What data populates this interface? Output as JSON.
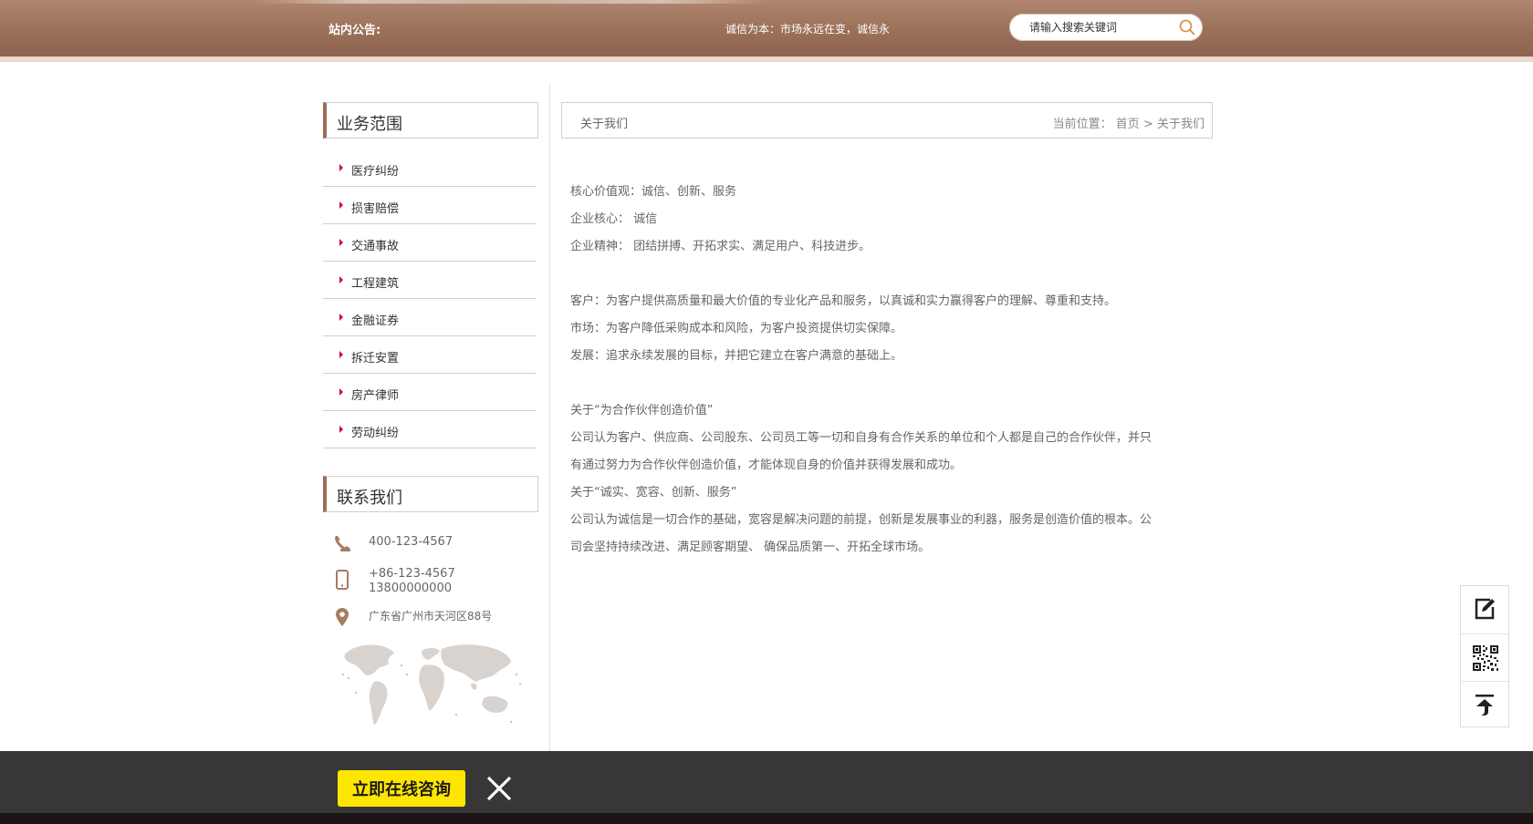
{
  "header": {
    "notice_label": "站内公告:",
    "notice_text": "诚信为本：市场永远在变，诚信永",
    "search_placeholder": "请输入搜索关键词"
  },
  "sidebar": {
    "business_title": "业务范围",
    "items": [
      {
        "label": "医疗纠纷"
      },
      {
        "label": "损害赔偿"
      },
      {
        "label": "交通事故"
      },
      {
        "label": "工程建筑"
      },
      {
        "label": "金融证券"
      },
      {
        "label": "拆迁安置"
      },
      {
        "label": "房产律师"
      },
      {
        "label": "劳动纠纷"
      }
    ],
    "contact_title": "联系我们",
    "contact": {
      "phone": "400-123-4567",
      "mobile_1": "+86-123-4567",
      "mobile_2": "13800000000",
      "address": "广东省广州市天河区88号"
    }
  },
  "breadcrumb": {
    "title": "关于我们",
    "prefix": "当前位置：",
    "home": "首页",
    "separator": ">",
    "current": "关于我们"
  },
  "content": {
    "lines": [
      "核心价值观：诚信、创新、服务",
      "企业核心： 诚信",
      "企业精神： 团结拼搏、开拓求实、满足用户、科技进步。",
      "客户：为客户提供高质量和最大价值的专业化产品和服务，以真诚和实力赢得客户的理解、尊重和支持。",
      "市场：为客户降低采购成本和风险，为客户投资提供切实保障。",
      "发展：追求永续发展的目标，并把它建立在客户满意的基础上。",
      "关于“为合作伙伴创造价值”",
      "公司认为客户、供应商、公司股东、公司员工等一切和自身有合作关系的单位和个人都是自己的合作伙伴，并只",
      "有通过努力为合作伙伴创造价值，才能体现自身的价值并获得发展和成功。",
      "关于“诚实、宽容、创新、服务”",
      "公司认为诚信是一切合作的基础，宽容是解决问题的前提，创新是发展事业的利器，服务是创造价值的根本。公",
      "司会坚持持续改进、满足顾客期望、 确保品质第一、开拓全球市场。"
    ]
  },
  "bottom_bar": {
    "consult_label": "立即在线咨询"
  },
  "colors": {
    "brand_brown": "#9b6e57",
    "bullet_red": "#c8102e",
    "consult_yellow": "#ffe600",
    "bottom_bar": "#373737"
  },
  "icons": {
    "search": "search-icon",
    "phone": "phone-icon",
    "mobile": "mobile-icon",
    "location": "location-pin-icon",
    "edit": "edit-icon",
    "qr": "qr-code-icon",
    "back_to_top": "back-to-top-icon",
    "close": "close-icon"
  }
}
